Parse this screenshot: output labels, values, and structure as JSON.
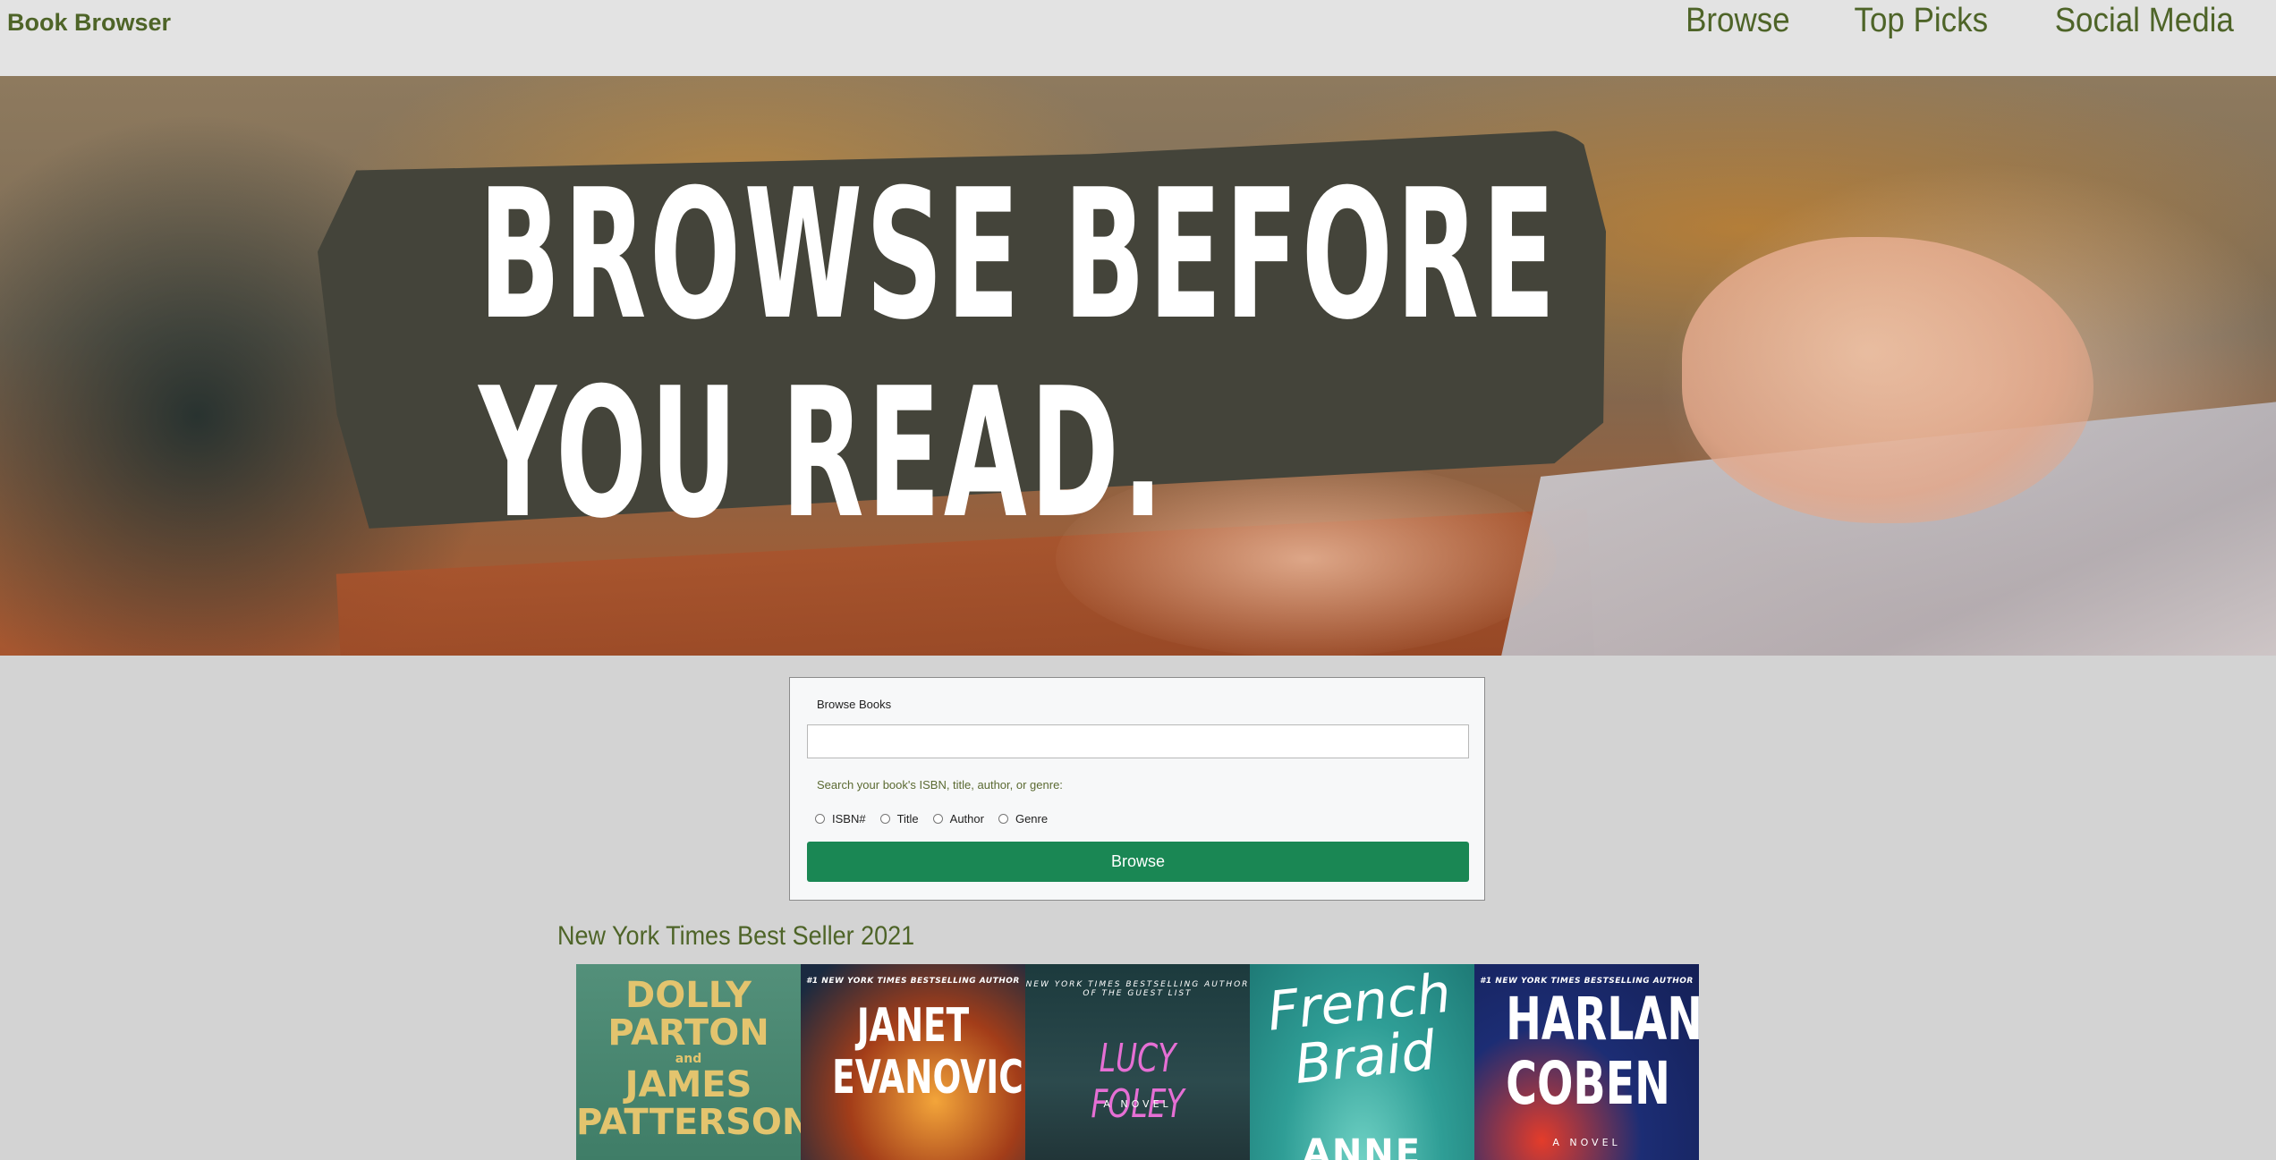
{
  "header": {
    "brand": "Book Browser",
    "nav": [
      "Browse",
      "Top Picks",
      "Social Media"
    ]
  },
  "hero": {
    "headline_line1": "BROWSE BEFORE",
    "headline_line2": "YOU READ."
  },
  "search": {
    "title": "Browse Books",
    "input_value": "",
    "hint": "Search your book's ISBN, title, author, or genre:",
    "options": [
      "ISBN#",
      "Title",
      "Author",
      "Genre"
    ],
    "button_label": "Browse"
  },
  "best_sellers": {
    "title": "New York Times Best Seller 2021",
    "books": [
      {
        "tag": "",
        "author_line1": "DOLLY",
        "author_line2": "PARTON",
        "connector": "and",
        "author_line3": "JAMES",
        "author_line4": "PATTERSON"
      },
      {
        "tag": "#1 NEW YORK TIMES BESTSELLING AUTHOR",
        "author_line1": "JANET",
        "author_line2": "EVANOVICH"
      },
      {
        "tag": "NEW YORK TIMES BESTSELLING AUTHOR OF THE GUEST LIST",
        "author": "LUCY FOLEY",
        "sub": "A NOVEL"
      },
      {
        "tag": "",
        "title_line1": "French",
        "title_line2": "Braid",
        "author_fragment": "ANNE"
      },
      {
        "tag": "#1 NEW YORK TIMES BESTSELLING AUTHOR",
        "author_line1": "HARLAN",
        "author_line2": "COBEN",
        "sub": "A NOVEL"
      }
    ]
  }
}
